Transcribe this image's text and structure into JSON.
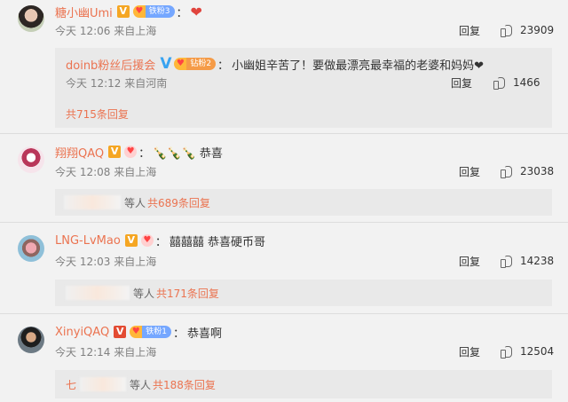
{
  "comments": [
    {
      "name": "糖小幽Umi",
      "badge": "V",
      "fan": "铁粉3",
      "colon": "：",
      "content": "❤",
      "time": "今天 12:06 来自上海",
      "reply": "回复",
      "likes": "23909",
      "sub": {
        "name": "doinb粉丝后援会",
        "badge": "V",
        "fan": "钻粉2",
        "colon": "：",
        "content": "小幽姐辛苦了！要做最漂亮最幸福的老婆和妈妈❤",
        "time": "今天 12:12 来自河南",
        "reply": "回复",
        "likes": "1466",
        "total": "共715条回复"
      }
    },
    {
      "name": "翔翔QAQ",
      "badge": "V",
      "colon": "：",
      "content": "🍾🍾🍾 恭喜",
      "time": "今天 12:08 来自上海",
      "reply": "回复",
      "likes": "23038",
      "more_prefix": "等人",
      "more": "共689条回复"
    },
    {
      "name": "LNG-LvMao",
      "badge": "V",
      "colon": "：",
      "content": "囍囍囍 恭喜硬币哥",
      "time": "今天 12:03 来自上海",
      "reply": "回复",
      "likes": "14238",
      "more_prefix": "等人",
      "more": "共171条回复"
    },
    {
      "name": "XinyiQAQ",
      "badge": "V",
      "fan": "铁粉1",
      "colon": "：",
      "content": "恭喜啊",
      "time": "今天 12:14 来自上海",
      "reply": "回复",
      "likes": "12504",
      "more_first": "七",
      "more_prefix": "等人",
      "more": "共188条回复"
    }
  ],
  "colors": {
    "name": "#eb7350",
    "background": "#f2f2f2",
    "sub_background": "#e9e9e9",
    "v_orange": "#f5a623",
    "v_red": "#e34b32",
    "v_blue": "#38a3f1",
    "fan_badge": "#75a7ff"
  }
}
